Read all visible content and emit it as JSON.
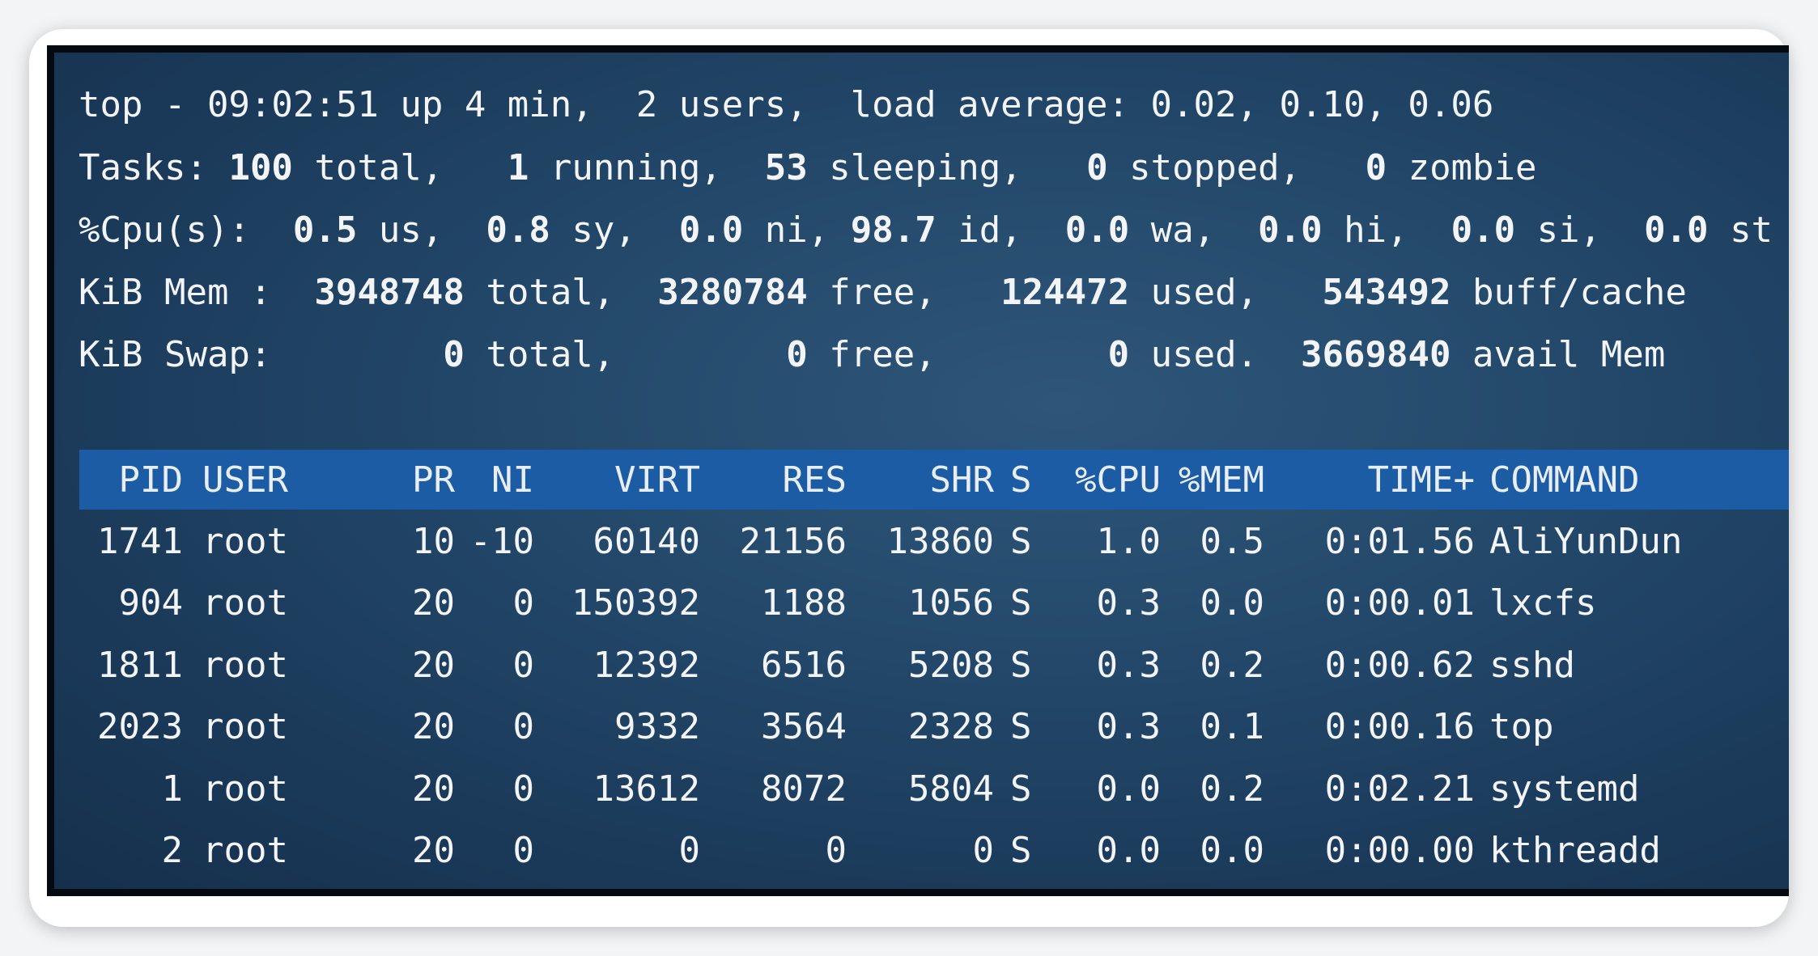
{
  "summary": {
    "line1": {
      "prefix": "top - 09:02:51 up 4 min,  2 users,  load average: 0.02, 0.10, 0.06"
    },
    "line2": {
      "label": "Tasks:",
      "total": "100",
      "total_label": "total,",
      "running": "1",
      "running_label": "running,",
      "sleeping": "53",
      "sleeping_label": "sleeping,",
      "stopped": "0",
      "stopped_label": "stopped,",
      "zombie": "0",
      "zombie_label": "zombie"
    },
    "line3": {
      "label": "%Cpu(s):",
      "us": "0.5",
      "us_label": "us,",
      "sy": "0.8",
      "sy_label": "sy,",
      "ni": "0.0",
      "ni_label": "ni,",
      "id": "98.7",
      "id_label": "id,",
      "wa": "0.0",
      "wa_label": "wa,",
      "hi": "0.0",
      "hi_label": "hi,",
      "si": "0.0",
      "si_label": "si,",
      "st": "0.0",
      "st_label": "st"
    },
    "line4": {
      "label": "KiB Mem :",
      "total": "3948748",
      "total_label": "total,",
      "free": "3280784",
      "free_label": "free,",
      "used": "124472",
      "used_label": "used,",
      "buff": "543492",
      "buff_label": "buff/cache"
    },
    "line5": {
      "label": "KiB Swap:",
      "total": "0",
      "total_label": "total,",
      "free": "0",
      "free_label": "free,",
      "used": "0",
      "used_label": "used.",
      "avail": "3669840",
      "avail_label": "avail Mem"
    }
  },
  "table": {
    "columns": [
      "PID",
      "USER",
      "PR",
      "NI",
      "VIRT",
      "RES",
      "SHR",
      "S",
      "%CPU",
      "%MEM",
      "TIME+",
      "COMMAND"
    ],
    "rows": [
      [
        "1741",
        "root",
        "10",
        "-10",
        "60140",
        "21156",
        "13860",
        "S",
        "1.0",
        "0.5",
        "0:01.56",
        "AliYunDun"
      ],
      [
        "904",
        "root",
        "20",
        "0",
        "150392",
        "1188",
        "1056",
        "S",
        "0.3",
        "0.0",
        "0:00.01",
        "lxcfs"
      ],
      [
        "1811",
        "root",
        "20",
        "0",
        "12392",
        "6516",
        "5208",
        "S",
        "0.3",
        "0.2",
        "0:00.62",
        "sshd"
      ],
      [
        "2023",
        "root",
        "20",
        "0",
        "9332",
        "3564",
        "2328",
        "S",
        "0.3",
        "0.1",
        "0:00.16",
        "top"
      ],
      [
        "1",
        "root",
        "20",
        "0",
        "13612",
        "8072",
        "5804",
        "S",
        "0.0",
        "0.2",
        "0:02.21",
        "systemd"
      ],
      [
        "2",
        "root",
        "20",
        "0",
        "0",
        "0",
        "0",
        "S",
        "0.0",
        "0.0",
        "0:00.00",
        "kthreadd"
      ]
    ]
  }
}
